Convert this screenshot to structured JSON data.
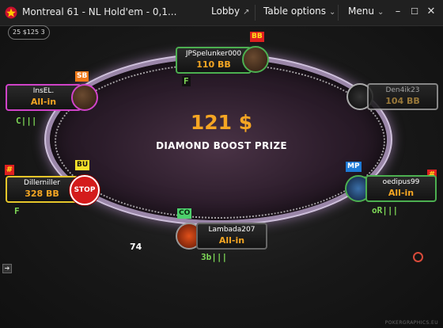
{
  "titlebar": {
    "title": "Montreal 61 - NL Hold'em - 0,1...",
    "lobby_label": "Lobby",
    "table_options_label": "Table options",
    "menu_label": "Menu"
  },
  "blinds_chip": "25 $125 3",
  "prize": {
    "amount": "121 $",
    "label": "DIAMOND BOOST PRIZE"
  },
  "seats": {
    "top": {
      "name": "JPSpelunker000",
      "stack": "110 BB",
      "badge": "BB",
      "note": "F"
    },
    "upper_left": {
      "name": "InsEL.",
      "stack": "All-in",
      "badge": "SB",
      "note": "C|||"
    },
    "upper_right": {
      "name": "Den4ik23",
      "stack": "104 BB"
    },
    "left": {
      "name": "Dillerniller",
      "stack": "328 BB",
      "badge": "BU",
      "note": "F",
      "hash": "#"
    },
    "right": {
      "name": "oedipus99",
      "stack": "All-in",
      "badge": "MP",
      "note": "oR|||",
      "hash": "#"
    },
    "bottom": {
      "name": "Lambada207",
      "stack": "All-in",
      "badge": "CO",
      "note": "3b|||"
    }
  },
  "stop_button": "STOP",
  "pot_counter": "74",
  "watermark": "POKERGRAPHICS.EU",
  "colors": {
    "accent": "#f5a623",
    "note_green": "#7ed957",
    "felt": "#2b1c2a"
  },
  "icons": [
    "pokerstars-logo-icon",
    "external-link-icon",
    "chevron-down-icon",
    "minimize-icon",
    "maximize-icon",
    "close-icon",
    "chip-icon",
    "side-arrow-icon"
  ]
}
